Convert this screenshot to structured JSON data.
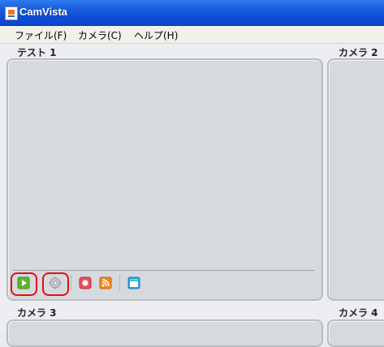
{
  "window": {
    "title": "CamVista"
  },
  "menu": [
    {
      "label": "ファイル(F)"
    },
    {
      "label": "カメラ(C)"
    },
    {
      "label": "ヘルプ(H)"
    }
  ],
  "panes": [
    {
      "label": "テスト 1"
    },
    {
      "label": "カメラ 2"
    },
    {
      "label": "カメラ 3"
    },
    {
      "label": "カメラ 4"
    }
  ],
  "toolbar": {
    "buttons": [
      {
        "icon": "play-icon",
        "color": "#5cb82e",
        "highlighted": true
      },
      {
        "icon": "gear-icon",
        "color": "#b7babd",
        "highlighted": true
      },
      {
        "icon": "record-icon",
        "color": "#e84f5f",
        "highlighted": false
      },
      {
        "icon": "rss-icon",
        "color": "#f08a1c",
        "highlighted": false
      },
      {
        "icon": "window-icon",
        "color": "#27a6e8",
        "highlighted": false
      }
    ]
  }
}
